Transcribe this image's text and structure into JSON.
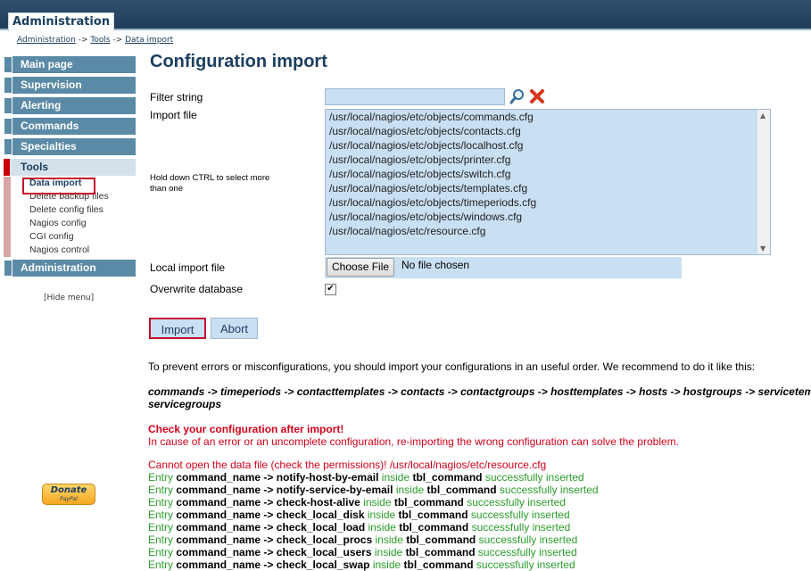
{
  "window": {
    "top_tab": "Administration"
  },
  "breadcrumb": {
    "items": [
      "Administration",
      "Tools",
      "Data import"
    ],
    "separator": "->"
  },
  "sidebar": {
    "menu_before": [
      "Main page",
      "Supervision",
      "Alerting",
      "Commands",
      "Specialties"
    ],
    "active_menu": "Tools",
    "submenu": [
      "Data import",
      "Delete backup files",
      "Delete config files",
      "Nagios config",
      "CGI config",
      "Nagios control"
    ],
    "current_submenu": "Data import",
    "menu_after": [
      "Administration"
    ],
    "hide_menu": "[Hide menu]"
  },
  "donate": {
    "label": "Donate",
    "sublabel": "PayPal"
  },
  "main": {
    "title": "Configuration import",
    "filter_label": "Filter string",
    "filter_value": "",
    "import_file_label": "Import file",
    "hint": "Hold down CTRL to select more than one",
    "files": [
      "/usr/local/nagios/etc/objects/commands.cfg",
      "/usr/local/nagios/etc/objects/contacts.cfg",
      "/usr/local/nagios/etc/objects/localhost.cfg",
      "/usr/local/nagios/etc/objects/printer.cfg",
      "/usr/local/nagios/etc/objects/switch.cfg",
      "/usr/local/nagios/etc/objects/templates.cfg",
      "/usr/local/nagios/etc/objects/timeperiods.cfg",
      "/usr/local/nagios/etc/objects/windows.cfg",
      "/usr/local/nagios/etc/resource.cfg"
    ],
    "local_import_label": "Local import file",
    "choose_file_label": "Choose File",
    "no_file_label": "No file chosen",
    "overwrite_label": "Overwrite database",
    "overwrite_checked": "✔",
    "import_button": "Import",
    "abort_button": "Abort",
    "info_text": "To prevent errors or misconfigurations, you should import your configurations in an useful order. We recommend to do it like this:",
    "order_line1": "commands -> timeperiods -> contacttemplates -> contacts -> contactgroups -> hosttemplates -> hosts -> hostgroups -> servicetem",
    "order_line2": "servicegroups",
    "check_title": "Check your configuration after import!",
    "check_text": "In cause of an error or an uncomplete configuration, re-importing the wrong configuration can solve the problem.",
    "error_line": "Cannot open the data file (check the permissions)! /usr/local/nagios/etc/resource.cfg",
    "log": [
      {
        "name": "notify-host-by-email"
      },
      {
        "name": "notify-service-by-email"
      },
      {
        "name": "check-host-alive"
      },
      {
        "name": "check_local_disk"
      },
      {
        "name": "check_local_load"
      },
      {
        "name": "check_local_procs"
      },
      {
        "name": "check_local_users"
      },
      {
        "name": "check_local_swap"
      }
    ],
    "log_words": {
      "entry": "Entry",
      "field": "command_name",
      "arrow": "->",
      "inside": "inside",
      "table": "tbl_command",
      "status": "successfully inserted"
    }
  },
  "colors": {
    "header": "#1f3d5a",
    "menu": "#5a8aa6",
    "accent_red": "#c8102e",
    "success": "#2a9d2a",
    "error": "#d0021b",
    "field_bg": "#c9dff2"
  }
}
